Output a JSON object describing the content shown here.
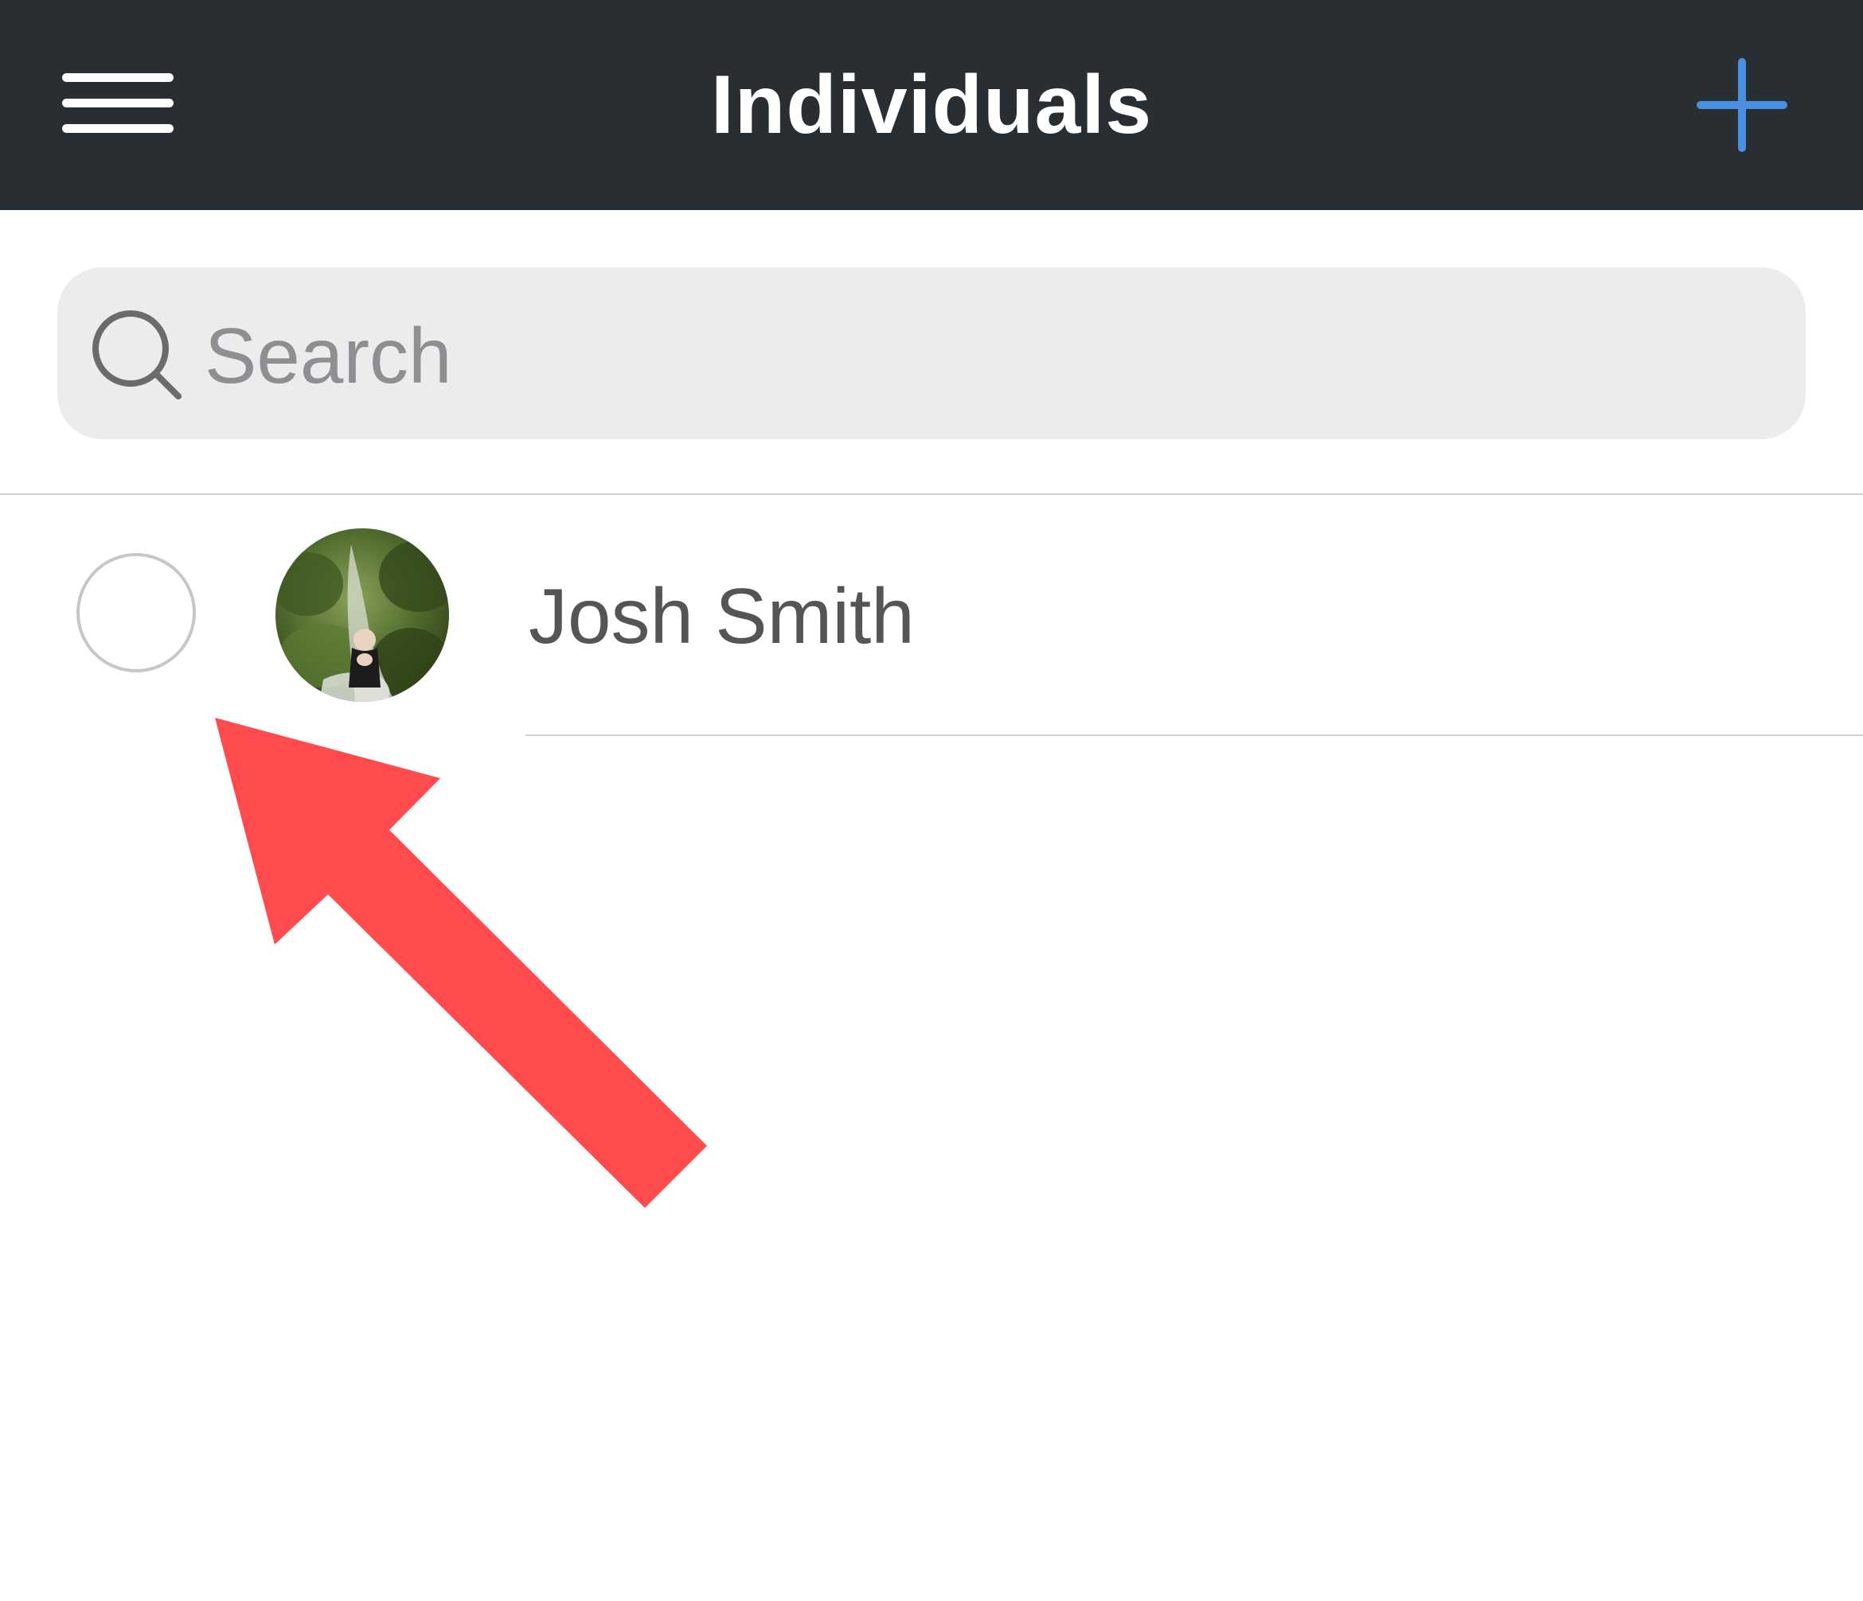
{
  "header": {
    "title": "Individuals",
    "menu_icon": "hamburger-menu-icon",
    "add_icon": "plus-icon",
    "background_color": "#292e32",
    "accent_color": "#4a90e2"
  },
  "search": {
    "placeholder": "Search",
    "value": "",
    "icon": "search-icon"
  },
  "list": {
    "items": [
      {
        "name": "Josh Smith",
        "selected": false,
        "avatar": "avatar-photo"
      }
    ]
  },
  "annotation": {
    "type": "arrow",
    "color": "#ff4b4e",
    "points_to": "select-circle"
  }
}
